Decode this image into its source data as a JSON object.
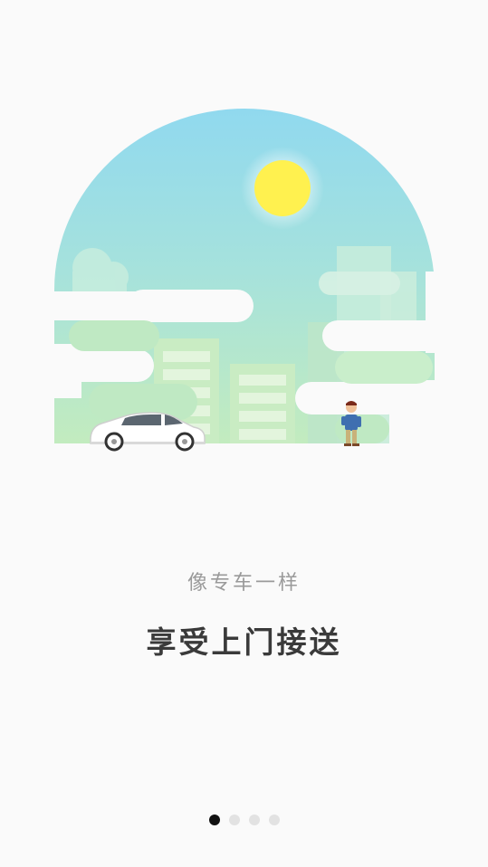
{
  "onboarding": {
    "subtitle": "像专车一样",
    "headline": "享受上门接送",
    "pager": {
      "count": 4,
      "active_index": 0
    }
  },
  "colors": {
    "background": "#fafafa",
    "sky_top": "#8fd9f0",
    "sky_bottom": "#bfeac0",
    "sun": "#fff04f",
    "cloud": "#fafafa",
    "car_body": "#ffffff",
    "active_dot": "#111111",
    "inactive_dot": "#e2e2e2",
    "subtitle_text": "#9a9a9a",
    "headline_text": "#3a3a3a"
  }
}
